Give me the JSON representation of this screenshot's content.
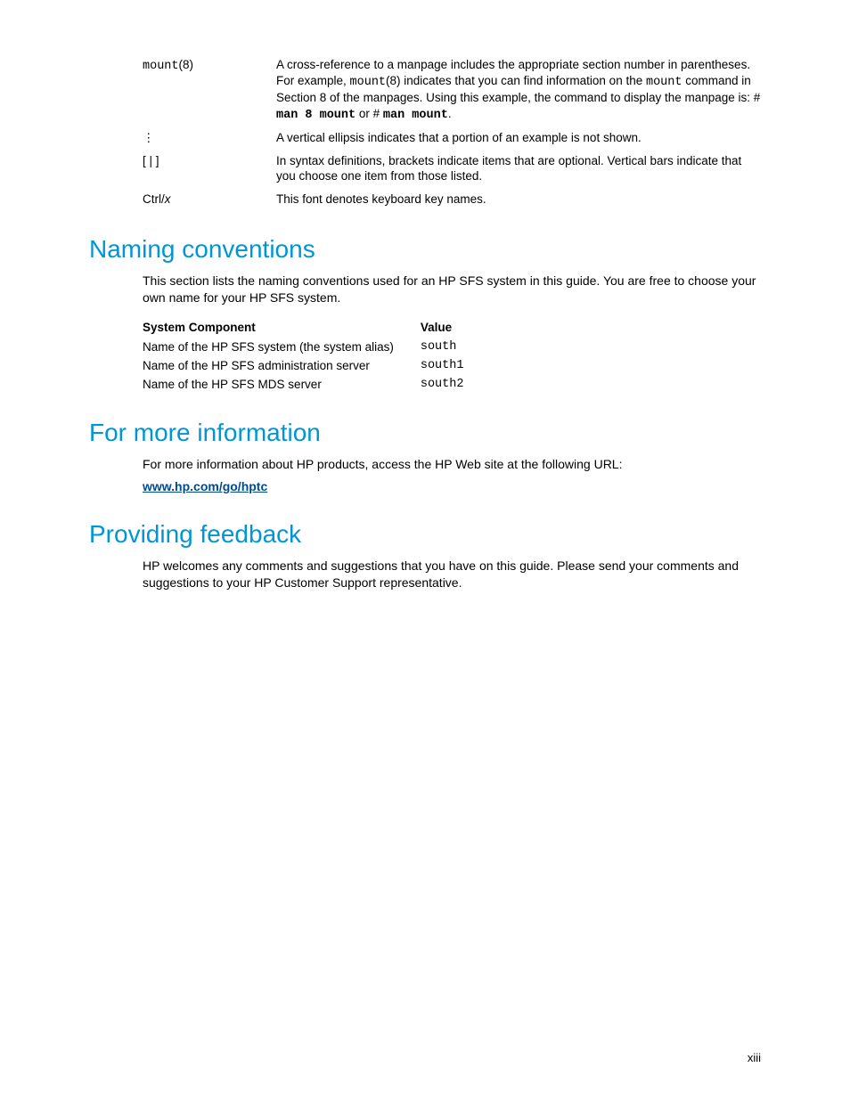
{
  "conventions": {
    "r1": {
      "term_mono": "mount",
      "term_rest": "(8)",
      "d1a": "A cross-reference to a manpage includes the appropriate section number in parentheses. For example, ",
      "d1b": "mount",
      "d1c": "(8) indicates that you can find information on the ",
      "d1d": "mount",
      "d1e": " command in Section 8 of the manpages. Using this example, the command to display the manpage is: # ",
      "d1f": "man 8 mount",
      "d1g": " or # ",
      "d1h": "man mount",
      "d1i": "."
    },
    "r2": {
      "term": "⋮",
      "def": "A vertical ellipsis indicates that a portion of an example is not shown."
    },
    "r3": {
      "term": "[ | ]",
      "def": "In syntax definitions, brackets indicate items that are optional. Vertical bars indicate that you choose one item from those listed."
    },
    "r4": {
      "term_a": "Ctrl/",
      "term_b": "x",
      "def": "This font denotes keyboard key names."
    }
  },
  "naming": {
    "heading": "Naming conventions",
    "intro": "This section lists the naming conventions used for an HP SFS system in this guide. You are free to choose your own name for your HP SFS system.",
    "th1": "System Component",
    "th2": "Value",
    "r1c1": "Name of the HP SFS system (the system alias)",
    "r1c2": "south",
    "r2c1": "Name of the HP SFS administration server",
    "r2c2": "south1",
    "r3c1": "Name of the HP SFS MDS server",
    "r3c2": "south2"
  },
  "moreinfo": {
    "heading": "For more information",
    "intro": "For more information about HP products, access the HP Web site at the following URL:",
    "link": "www.hp.com/go/hptc"
  },
  "feedback": {
    "heading": "Providing feedback",
    "body": "HP welcomes any comments and suggestions that you have on this guide. Please send your comments and suggestions to your HP Customer Support representative."
  },
  "page_num": "xiii"
}
